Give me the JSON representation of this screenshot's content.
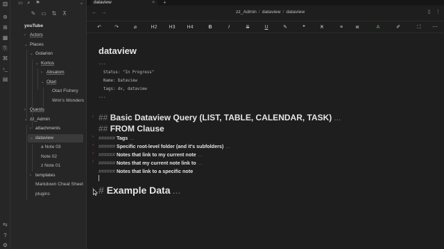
{
  "tab": {
    "title": "dataview",
    "close": "×",
    "new": "+"
  },
  "breadcrumb": [
    "zz_Admin",
    "dataview",
    "dataview"
  ],
  "vault": {
    "name": "youTube"
  },
  "tree": [
    {
      "label": "Actors",
      "depth": 0,
      "kind": "folder-link",
      "open": false
    },
    {
      "label": "Places",
      "depth": 0,
      "kind": "folder",
      "open": true
    },
    {
      "label": "Golarion",
      "depth": 1,
      "kind": "folder",
      "open": true
    },
    {
      "label": "Kortos",
      "depth": 2,
      "kind": "folder-link",
      "open": true
    },
    {
      "label": "Absalom",
      "depth": 3,
      "kind": "folder-link",
      "open": false
    },
    {
      "label": "Otari",
      "depth": 3,
      "kind": "folder-link",
      "open": true
    },
    {
      "label": "Otari Fishery",
      "depth": 4,
      "kind": "file"
    },
    {
      "label": "Wrin's Wonders",
      "depth": 4,
      "kind": "file"
    },
    {
      "label": "Quests",
      "depth": 0,
      "kind": "folder-link",
      "open": false
    },
    {
      "label": "zz_Admin",
      "depth": 0,
      "kind": "folder",
      "open": true
    },
    {
      "label": "attachments",
      "depth": 1,
      "kind": "folder",
      "open": false
    },
    {
      "label": "dataview",
      "depth": 1,
      "kind": "folder",
      "open": true,
      "active": true
    },
    {
      "label": "a Note 03",
      "depth": 2,
      "kind": "file"
    },
    {
      "label": "Note 02",
      "depth": 2,
      "kind": "file"
    },
    {
      "label": "z Note 01",
      "depth": 2,
      "kind": "file"
    },
    {
      "label": "templates",
      "depth": 1,
      "kind": "folder",
      "open": false
    },
    {
      "label": "Markdown Cheat Sheet",
      "depth": 1,
      "kind": "file"
    },
    {
      "label": "plugins",
      "depth": 1,
      "kind": "file"
    }
  ],
  "toolbar": [
    "↶",
    "↷",
    "⌀",
    "H2",
    "H3",
    "H4",
    "B",
    "I",
    "S",
    "U",
    "✎",
    "❝",
    "Ӿ",
    "≡",
    "≣",
    "A",
    "✐",
    "⛶",
    "⋯"
  ],
  "editor": {
    "title": "dataview",
    "frontmatter": [
      "---",
      "  Status: \"In Progress\"",
      "  Name: Dataview",
      "  tags: dv, dataview",
      "---"
    ],
    "headings": [
      {
        "hash": "##",
        "text": "Basic Dataview Query (LIST, TABLE, CALENDAR, TASK)",
        "more": "...",
        "folded": true
      },
      {
        "hash": "##",
        "text": "FROM Clause",
        "more": "",
        "folded": false
      },
      {
        "hash": "######",
        "text": "Tags",
        "more": "...",
        "folded": true
      },
      {
        "hash": "######",
        "text": "Specific root-level folder (and it's subfolders)",
        "more": "...",
        "folded": true
      },
      {
        "hash": "######",
        "text": "Notes that link to my current note",
        "more": "...",
        "folded": true
      },
      {
        "hash": "######",
        "text": "Notes that my current note link to",
        "more": "...",
        "folded": true
      },
      {
        "hash": "######",
        "text": "Notes that link to a specific note",
        "more": "",
        "folded": false
      },
      {
        "hash": "#",
        "text": "Example Data",
        "more": "...",
        "folded": true
      }
    ]
  },
  "colors": {
    "accent": "#c03fae",
    "background": "#1e1e1e",
    "sidebar": "#262626",
    "highlight_green": "#4ec04e"
  }
}
